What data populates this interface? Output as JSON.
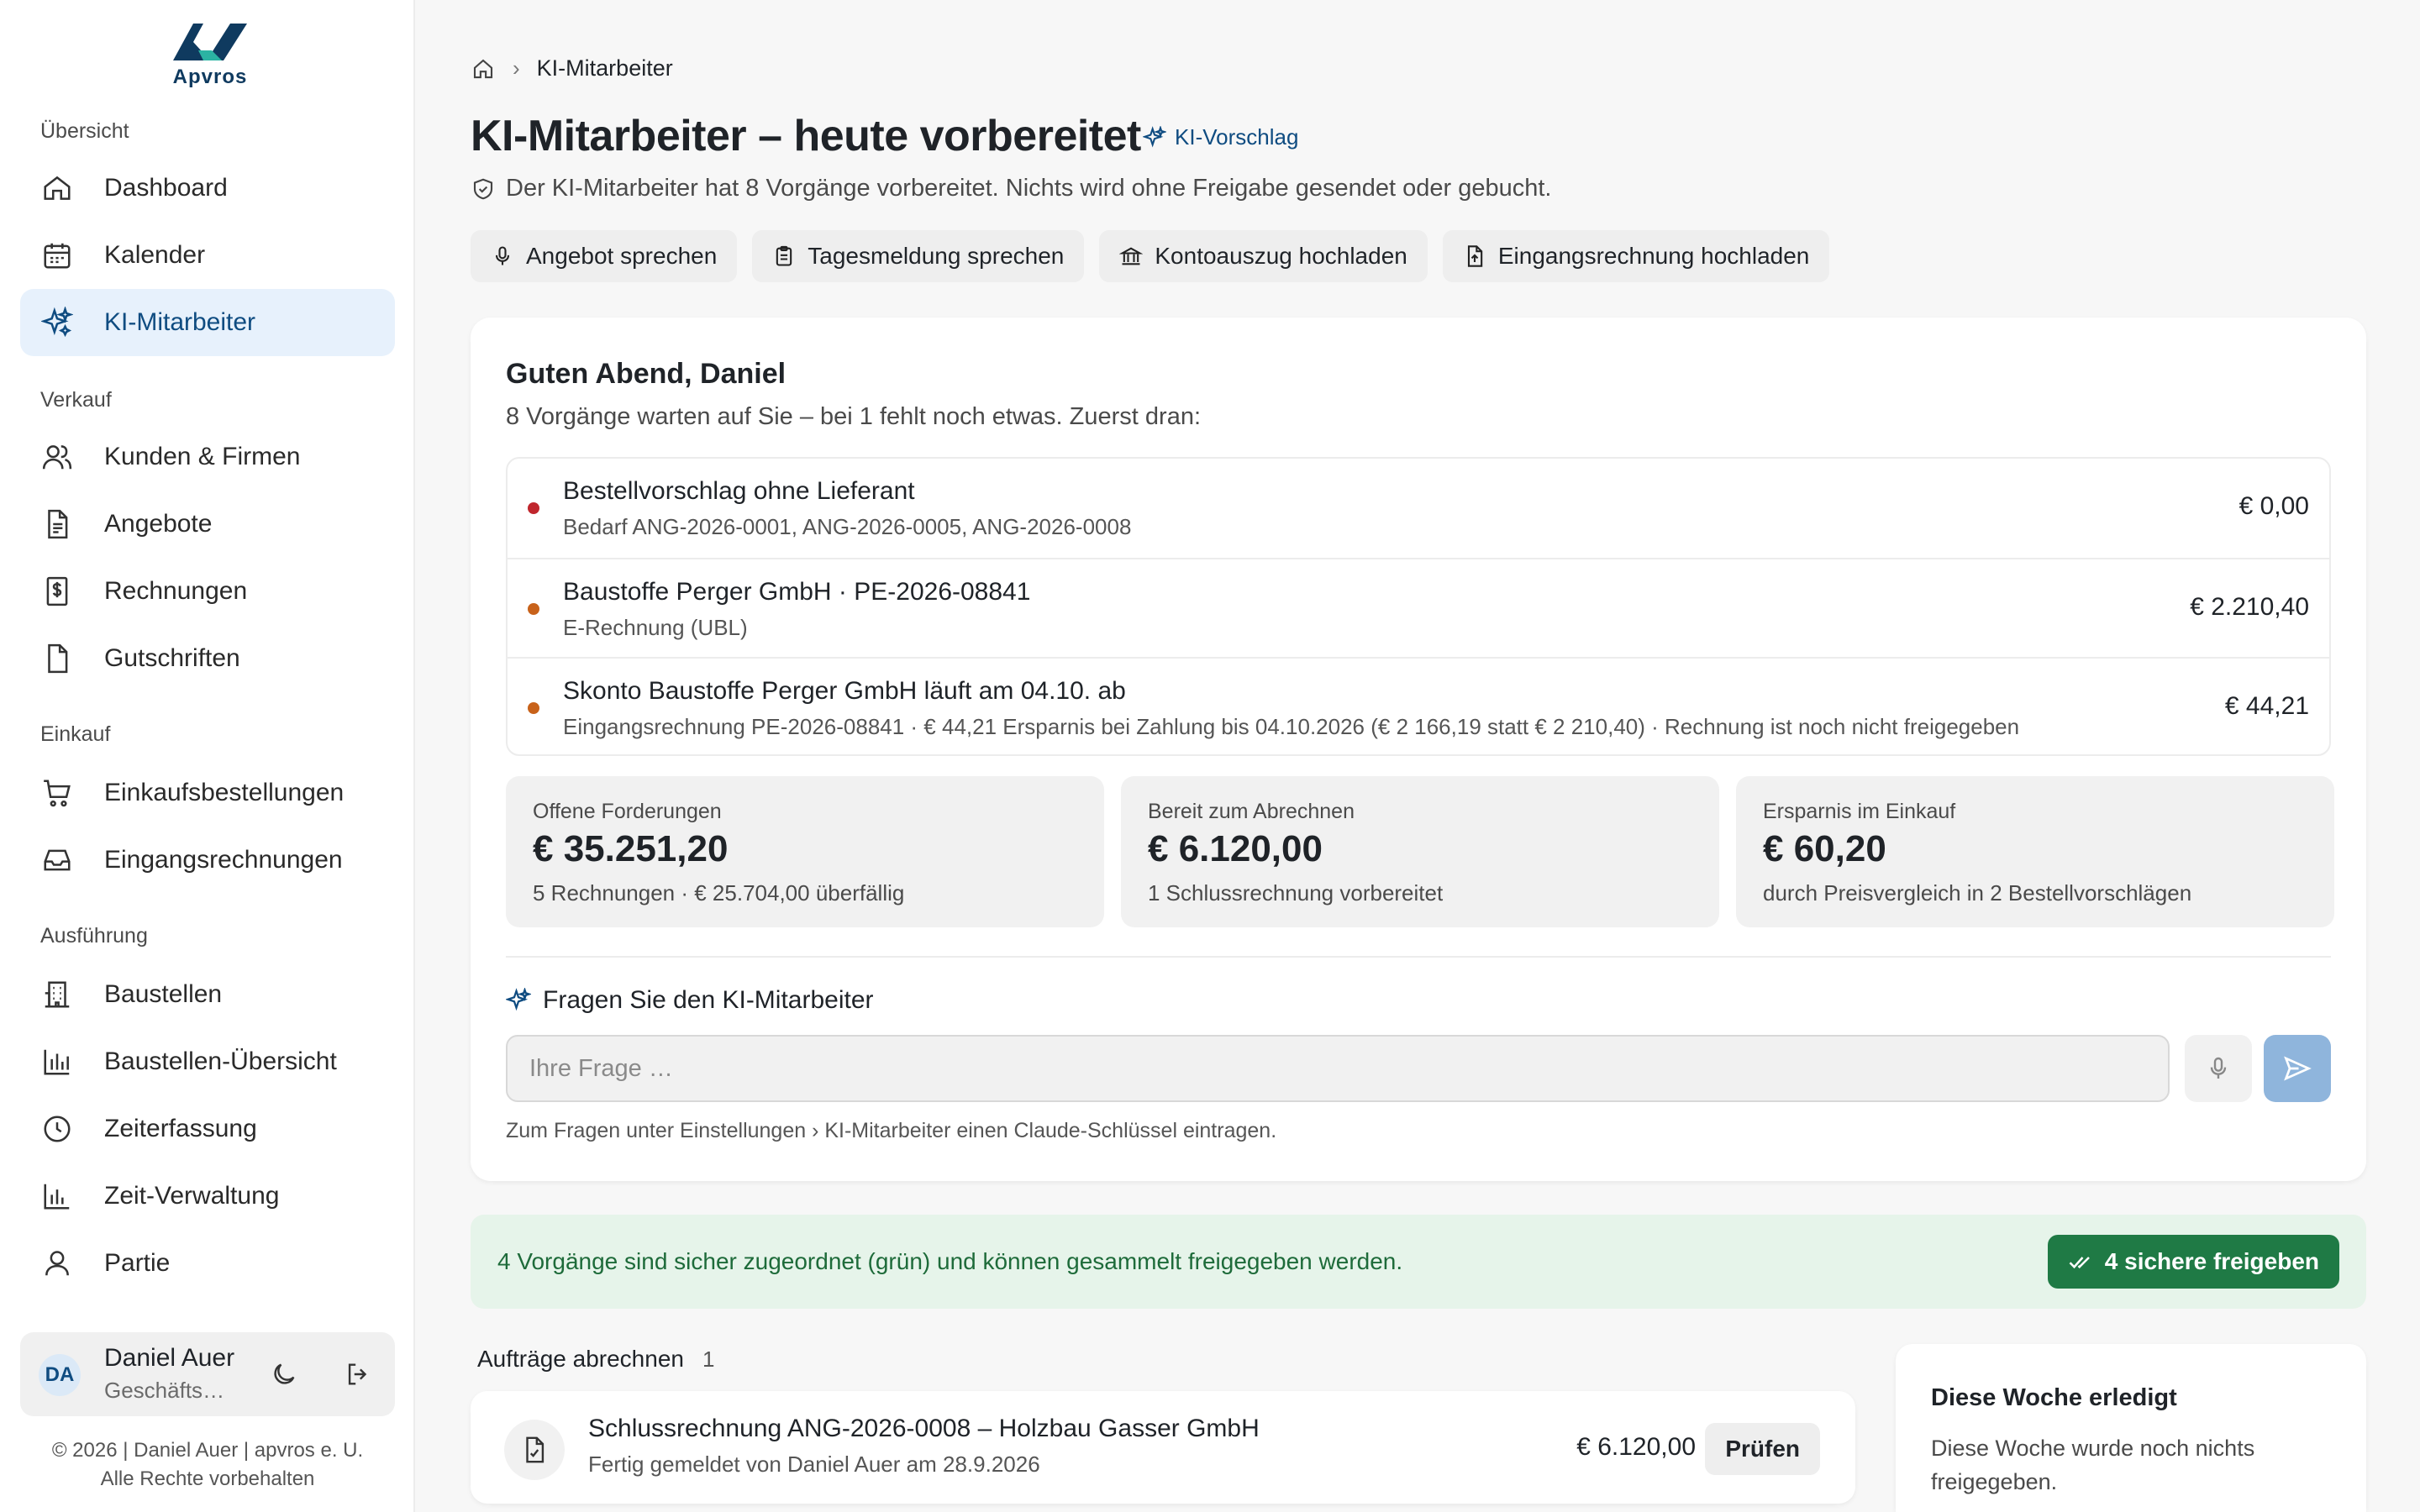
{
  "brand": {
    "name": "Apvros"
  },
  "sidebar": {
    "sections": [
      {
        "label": "Übersicht",
        "items": [
          {
            "label": "Dashboard",
            "icon": "home-icon"
          },
          {
            "label": "Kalender",
            "icon": "calendar-icon"
          },
          {
            "label": "KI-Mitarbeiter",
            "icon": "sparkles-icon",
            "active": true
          }
        ]
      },
      {
        "label": "Verkauf",
        "items": [
          {
            "label": "Kunden & Firmen",
            "icon": "users-icon"
          },
          {
            "label": "Angebote",
            "icon": "document-icon"
          },
          {
            "label": "Rechnungen",
            "icon": "invoice-dollar-icon"
          },
          {
            "label": "Gutschriften",
            "icon": "document-blank-icon"
          }
        ]
      },
      {
        "label": "Einkauf",
        "items": [
          {
            "label": "Einkaufsbestellungen",
            "icon": "cart-icon"
          },
          {
            "label": "Eingangsrechnungen",
            "icon": "inbox-icon"
          }
        ]
      },
      {
        "label": "Ausführung",
        "items": [
          {
            "label": "Baustellen",
            "icon": "building-icon"
          },
          {
            "label": "Baustellen-Übersicht",
            "icon": "bar-chart-icon"
          },
          {
            "label": "Zeiterfassung",
            "icon": "clock-icon"
          },
          {
            "label": "Zeit-Verwaltung",
            "icon": "bar-chart-icon"
          },
          {
            "label": "Partie",
            "icon": "user-icon"
          }
        ]
      }
    ],
    "user": {
      "initials": "DA",
      "name": "Daniel Auer",
      "role": "Geschäftsführer"
    },
    "footer": {
      "line1": "© 2026 | Daniel Auer | apvros e. U.",
      "line2": "Alle Rechte vorbehalten"
    }
  },
  "breadcrumb": {
    "current": "KI-Mitarbeiter"
  },
  "header": {
    "title": "KI-Mitarbeiter – heute vorbereitet",
    "badge": "KI-Vorschlag",
    "subtitle": "Der KI-Mitarbeiter hat 8 Vorgänge vorbereitet. Nichts wird ohne Freigabe gesendet oder gebucht."
  },
  "actions": [
    {
      "label": "Angebot sprechen",
      "icon": "mic-icon"
    },
    {
      "label": "Tagesmeldung sprechen",
      "icon": "clipboard-icon"
    },
    {
      "label": "Kontoauszug hochladen",
      "icon": "bank-icon"
    },
    {
      "label": "Eingangsrechnung hochladen",
      "icon": "file-upload-icon"
    }
  ],
  "greeting": {
    "title": "Guten Abend, Daniel",
    "subtitle": "8 Vorgänge warten auf Sie – bei 1 fehlt noch etwas. Zuerst dran:"
  },
  "tasks": [
    {
      "title": "Bestellvorschlag ohne Lieferant",
      "sub": "Bedarf ANG-2026-0001, ANG-2026-0005, ANG-2026-0008",
      "amount": "€ 0,00",
      "color": "#c0262d"
    },
    {
      "title": "Baustoffe Perger GmbH · PE-2026-08841",
      "sub": "E-Rechnung (UBL)",
      "amount": "€ 2.210,40",
      "color": "#c8621a"
    },
    {
      "title": "Skonto Baustoffe Perger GmbH läuft am 04.10. ab",
      "sub": "Eingangsrechnung PE-2026-08841 · € 44,21 Ersparnis bei Zahlung bis 04.10.2026 (€ 2 166,19 statt € 2 210,40) · Rechnung ist noch nicht freigegeben",
      "amount": "€ 44,21",
      "color": "#c8621a"
    }
  ],
  "kpis": [
    {
      "label": "Offene Forderungen",
      "value": "€ 35.251,20",
      "sub": "5 Rechnungen · € 25.704,00 überfällig"
    },
    {
      "label": "Bereit zum Abrechnen",
      "value": "€ 6.120,00",
      "sub": "1 Schlussrechnung vorbereitet"
    },
    {
      "label": "Ersparnis im Einkauf",
      "value": "€ 60,20",
      "sub": "durch Preisvergleich in 2 Bestellvorschlägen"
    }
  ],
  "ask": {
    "title": "Fragen Sie den KI-Mitarbeiter",
    "placeholder": "Ihre Frage …",
    "hint": "Zum Fragen unter Einstellungen › KI-Mitarbeiter einen Claude-Schlüssel eintragen."
  },
  "banner": {
    "text": "4 Vorgänge sind sicher zugeordnet (grün) und können gesammelt freigegeben werden.",
    "button": "4 sichere freigeben"
  },
  "orders": {
    "title": "Aufträge abrechnen",
    "count": "1",
    "items": [
      {
        "title": "Schlussrechnung ANG-2026-0008 – Holzbau Gasser GmbH",
        "sub": "Fertig gemeldet von Daniel Auer am 28.9.2026",
        "amount": "€ 6.120,00",
        "button": "Prüfen"
      }
    ]
  },
  "week": {
    "title": "Diese Woche erledigt",
    "text": "Diese Woche wurde noch nichts freigegeben."
  },
  "colors": {
    "accent": "#0f4c81",
    "active_bg": "#e7f1fc",
    "success": "#1f7a45",
    "success_bg": "#e6f4ea"
  }
}
